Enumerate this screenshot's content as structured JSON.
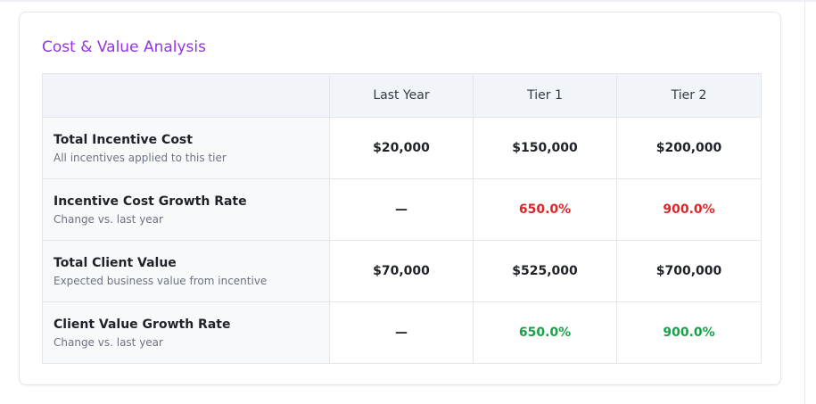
{
  "card": {
    "title": "Cost & Value Analysis"
  },
  "table": {
    "headers": [
      "",
      "Last Year",
      "Tier 1",
      "Tier 2"
    ],
    "rows": [
      {
        "name": "Total Incentive Cost",
        "description": "All incentives applied to this tier",
        "values": [
          "$20,000",
          "$150,000",
          "$200,000"
        ]
      },
      {
        "name": "Incentive Cost Growth Rate",
        "description": "Change vs. last year",
        "values": [
          "—",
          "650.0%",
          "900.0%"
        ]
      },
      {
        "name": "Total Client Value",
        "description": "Expected business value from incentive",
        "values": [
          "$70,000",
          "$525,000",
          "$700,000"
        ]
      },
      {
        "name": "Client Value Growth Rate",
        "description": "Change vs. last year",
        "values": [
          "—",
          "650.0%",
          "900.0%"
        ]
      }
    ]
  },
  "colors": {
    "title_accent": "#9333ea",
    "negative_growth": "#dc2626",
    "positive_growth": "#16a34a"
  }
}
